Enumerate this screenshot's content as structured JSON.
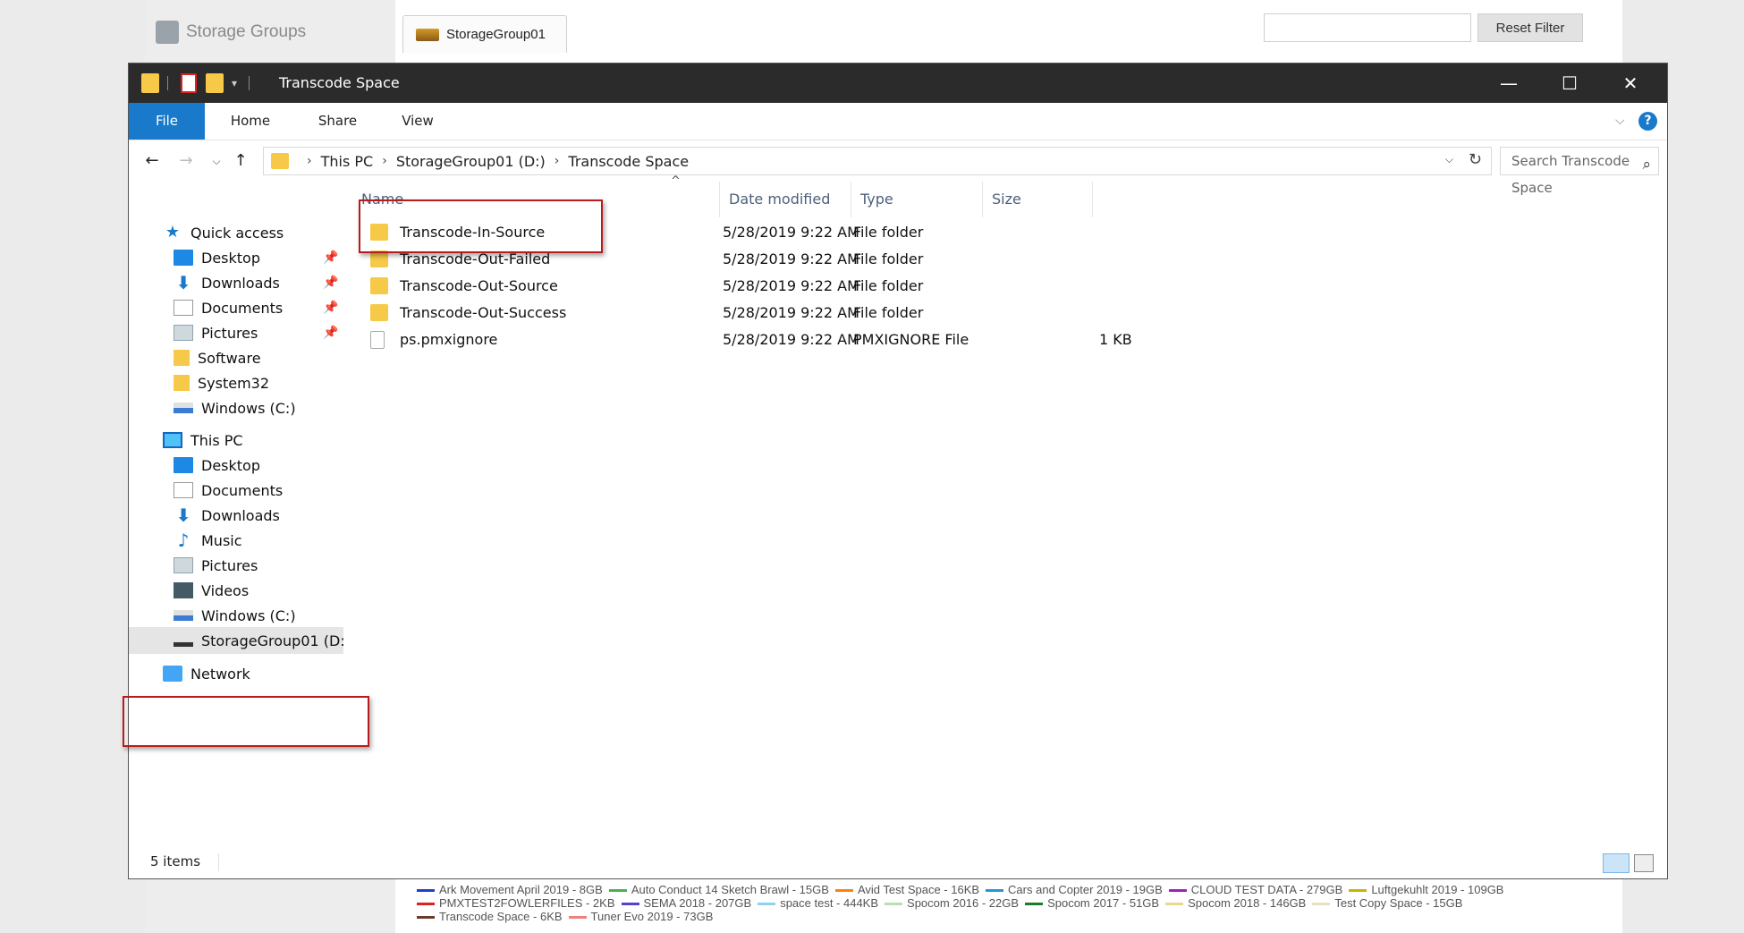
{
  "background_app": {
    "sidebar_title": "Storage Groups",
    "tab_label": "StorageGroup01",
    "filter_placeholder": "",
    "reset_filter_label": "Reset Filter",
    "legend": [
      {
        "label": "Ark Movement April 2019 - 8GB",
        "color": "#1f3fd1"
      },
      {
        "label": "Auto Conduct 14 Sketch Brawl - 15GB",
        "color": "#4caf50"
      },
      {
        "label": "Avid Test Space - 16KB",
        "color": "#ff7f0e"
      },
      {
        "label": "Cars and Copter 2019 - 19GB",
        "color": "#1f9bd1"
      },
      {
        "label": "CLOUD TEST DATA - 279GB",
        "color": "#a020c0"
      },
      {
        "label": "Luftgekuhlt 2019 - 109GB",
        "color": "#c8b400"
      },
      {
        "label": "PMXTEST2FOWLERFILES - 2KB",
        "color": "#e02020"
      },
      {
        "label": "SEMA 2018 - 207GB",
        "color": "#5a3fd1"
      },
      {
        "label": "space test - 444KB",
        "color": "#8ed1f0"
      },
      {
        "label": "Spocom 2016 - 22GB",
        "color": "#b8e0b0"
      },
      {
        "label": "Spocom 2017 - 51GB",
        "color": "#1e7a2a"
      },
      {
        "label": "Spocom 2018 - 146GB",
        "color": "#e8d890"
      },
      {
        "label": "Test Copy Space - 15GB",
        "color": "#e8e0c0"
      },
      {
        "label": "Transcode Space - 6KB",
        "color": "#6d3b2a"
      },
      {
        "label": "Tuner Evo 2019 - 73GB",
        "color": "#f08080"
      }
    ]
  },
  "window": {
    "title": "Transcode Space",
    "controls": {
      "minimize": "—",
      "maximize": "☐",
      "close": "✕"
    }
  },
  "ribbon": {
    "tabs": [
      "File",
      "Home",
      "Share",
      "View"
    ],
    "expand": "⌵",
    "help": "?"
  },
  "address_bar": {
    "back": "←",
    "forward": "→",
    "recent": "⌵",
    "up": "↑",
    "crumbs": [
      "This PC",
      "StorageGroup01 (D:)",
      "Transcode Space"
    ],
    "separator": "›",
    "dropdown": "⌵",
    "refresh": "↻"
  },
  "search": {
    "placeholder": "Search Transcode Space",
    "icon": "⌕"
  },
  "nav_pane": {
    "pin": "📌",
    "quick_access": {
      "label": "Quick access",
      "items": [
        "Desktop",
        "Downloads",
        "Documents",
        "Pictures",
        "Software",
        "System32",
        "Windows (C:)"
      ]
    },
    "this_pc": {
      "label": "This PC",
      "items": [
        "Desktop",
        "Documents",
        "Downloads",
        "Music",
        "Pictures",
        "Videos",
        "Windows (C:)",
        "StorageGroup01 (D:"
      ]
    },
    "network": "Network"
  },
  "columns": {
    "name": "Name",
    "date": "Date modified",
    "type": "Type",
    "size": "Size",
    "sort": "^"
  },
  "files": [
    {
      "name": "Transcode-In-Source",
      "date": "5/28/2019 9:22 AM",
      "type": "File folder",
      "size": ""
    },
    {
      "name": "Transcode-Out-Failed",
      "date": "5/28/2019 9:22 AM",
      "type": "File folder",
      "size": ""
    },
    {
      "name": "Transcode-Out-Source",
      "date": "5/28/2019 9:22 AM",
      "type": "File folder",
      "size": ""
    },
    {
      "name": "Transcode-Out-Success",
      "date": "5/28/2019 9:22 AM",
      "type": "File folder",
      "size": ""
    },
    {
      "name": "ps.pmxignore",
      "date": "5/28/2019 9:22 AM",
      "type": "PMXIGNORE File",
      "size": "1 KB"
    }
  ],
  "status": {
    "item_count": "5 items"
  },
  "colors": {
    "accent": "#1979ca",
    "highlight_box": "#b71c1c",
    "folder": "#f7c948"
  }
}
